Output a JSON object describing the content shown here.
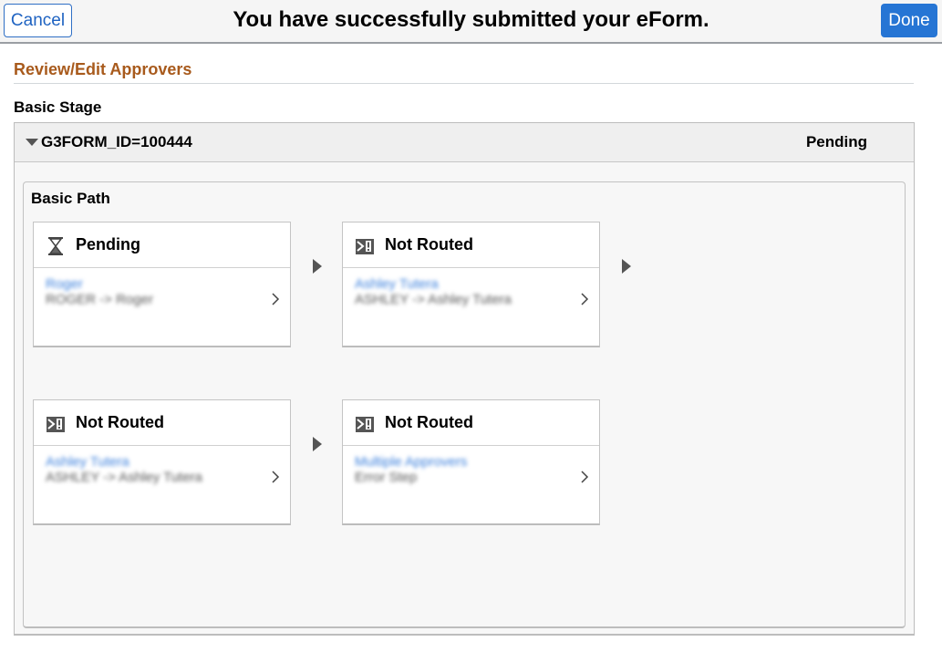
{
  "topbar": {
    "cancel_label": "Cancel",
    "title": "You have successfully submitted your eForm.",
    "done_label": "Done",
    "done_color": "#2675d4"
  },
  "section": {
    "title": "Review/Edit Approvers",
    "title_color": "#a85a1c"
  },
  "stage": {
    "label": "Basic Stage",
    "id_text": "G3FORM_ID=100444",
    "status": "Pending",
    "caret_icon": "caret-down-icon",
    "path": {
      "title": "Basic Path",
      "steps": [
        {
          "status": "Pending",
          "icon": "hourglass-icon",
          "approver": "Roger",
          "detail": "ROGER -> Roger"
        },
        {
          "status": "Not Routed",
          "icon": "not-routed-icon",
          "approver": "Ashley Tutera",
          "detail": "ASHLEY -> Ashley Tutera"
        },
        {
          "status": "Not Routed",
          "icon": "not-routed-icon",
          "approver": "Ashley Tutera",
          "detail": "ASHLEY -> Ashley Tutera"
        },
        {
          "status": "Not Routed",
          "icon": "not-routed-icon",
          "approver": "Multiple Approvers",
          "detail": "Error Step"
        }
      ]
    }
  }
}
